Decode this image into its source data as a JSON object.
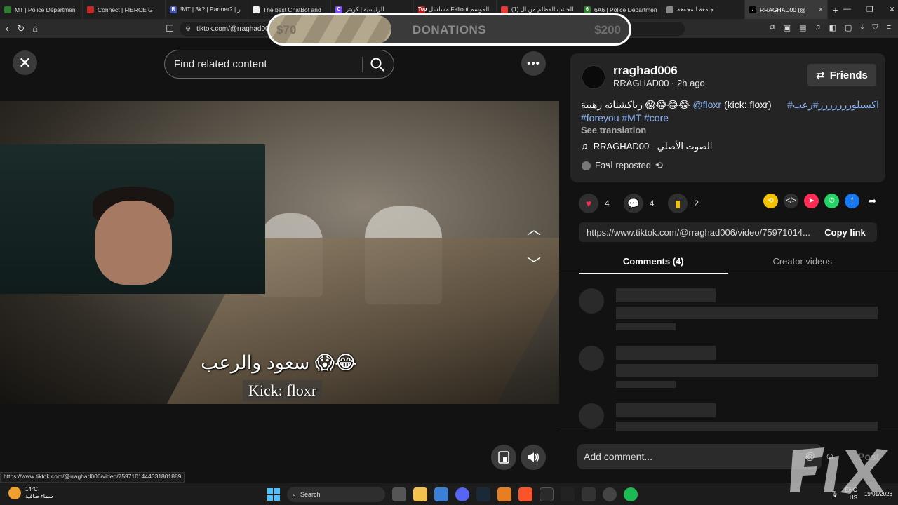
{
  "browser": {
    "tabs": [
      {
        "label": "MT | Police Departmen",
        "color": "#2e7d32",
        "icon_text": ""
      },
      {
        "label": "Connect | FIERCE G",
        "color": "#c62828",
        "icon_text": ""
      },
      {
        "label": "!MT | 3k? | Partner? | ر",
        "color": "#3f51b5",
        "icon_text": "R"
      },
      {
        "label": "The best ChatBot and",
        "color": "#eeeeee",
        "icon_text": ""
      },
      {
        "label": "الرئيسية | كريتر",
        "color": "#7c4dff",
        "icon_text": "C"
      },
      {
        "label": "مسلسل Fallout الموسم",
        "color": "#b71c1c",
        "icon_text": "Top"
      },
      {
        "label": "(1) الجانب المظلم من ال",
        "color": "#e53935",
        "icon_text": ""
      },
      {
        "label": "6A6 | Police Departmen",
        "color": "#2e7d32",
        "icon_text": "6"
      },
      {
        "label": "جامعة المجمعة",
        "color": "#888888",
        "icon_text": ""
      },
      {
        "label": "RRAGHAD00 (@",
        "color": "#000000",
        "icon_text": "♪",
        "active": true
      }
    ],
    "new_tab": "+",
    "url": "tiktok.com/@rraghad006",
    "window_controls": [
      "—",
      "❐",
      "✕"
    ]
  },
  "donation": {
    "label": "DONATIONS",
    "min": "$70",
    "max": "$200",
    "progress": 0.34
  },
  "player": {
    "find_placeholder": "Find related content",
    "caption_arabic": "😂😱 سعود والرعب",
    "caption_kick": "Kick: floxr",
    "status_url": "https://www.tiktok.com/@rraghad006/video/7597101444331801889"
  },
  "post": {
    "username": "rraghad006",
    "handle_time": "RRAGHAD00 · 2h ago",
    "friends_label": "Friends",
    "description_prefix": "اكسبلوررررررر#رعب# ",
    "description_mention": "@floxr",
    "description_mid": " (kick: floxr) ",
    "description_arabic": "رياكشناته رهيبة 😱😂😂😂 ",
    "hashtags": [
      "#foreyou",
      "#MT",
      "#core"
    ],
    "see_translation": "See translation",
    "music": "RRAGHAD00 - الصوت الأصلي",
    "repost_text": "Faا۹ reposted",
    "likes": "4",
    "comments": "4",
    "saves": "2",
    "link": "https://www.tiktok.com/@rraghad006/video/75971014...",
    "copy_link": "Copy link",
    "tab_comments": "Comments (4)",
    "tab_creator": "Creator videos",
    "add_comment": "Add comment...",
    "post_button": "Post"
  },
  "share_colors": [
    "#f5c400",
    "#2f2f2f",
    "#fe2c55",
    "#25d366",
    "#1877f2"
  ],
  "taskbar": {
    "temp": "14°C",
    "weather": "سماء صافية",
    "search": "Search",
    "lang": "ENG",
    "region": "US",
    "time": "",
    "date": "19/01/2026"
  }
}
